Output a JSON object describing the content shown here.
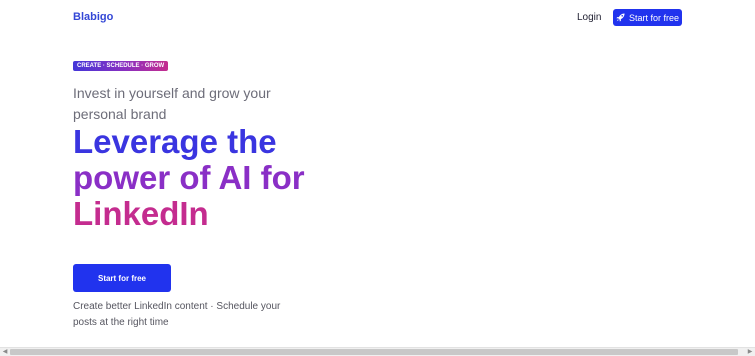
{
  "header": {
    "logo_text": "Blabigo",
    "login_label": "Login",
    "cta_label": "Start for free",
    "cta_icon": "rocket-icon"
  },
  "hero": {
    "badge": "CREATE · SCHEDULE · GROW",
    "subtitle": "Invest in yourself and grow your personal brand",
    "headline_lines": [
      "Leverage the",
      "power of AI for",
      "LinkedIn"
    ],
    "cta_label": "Start for free",
    "description": "Create better LinkedIn content · Schedule your posts at the right time"
  },
  "colors": {
    "brand_blue": "#2133ee",
    "headline_blue": "#3a35e0",
    "headline_purple": "#8a2fc6",
    "headline_pink": "#c42c8f",
    "logo": "#3347d6"
  },
  "scrollbar": {
    "left_arrow": "◀",
    "right_arrow": "▶"
  }
}
